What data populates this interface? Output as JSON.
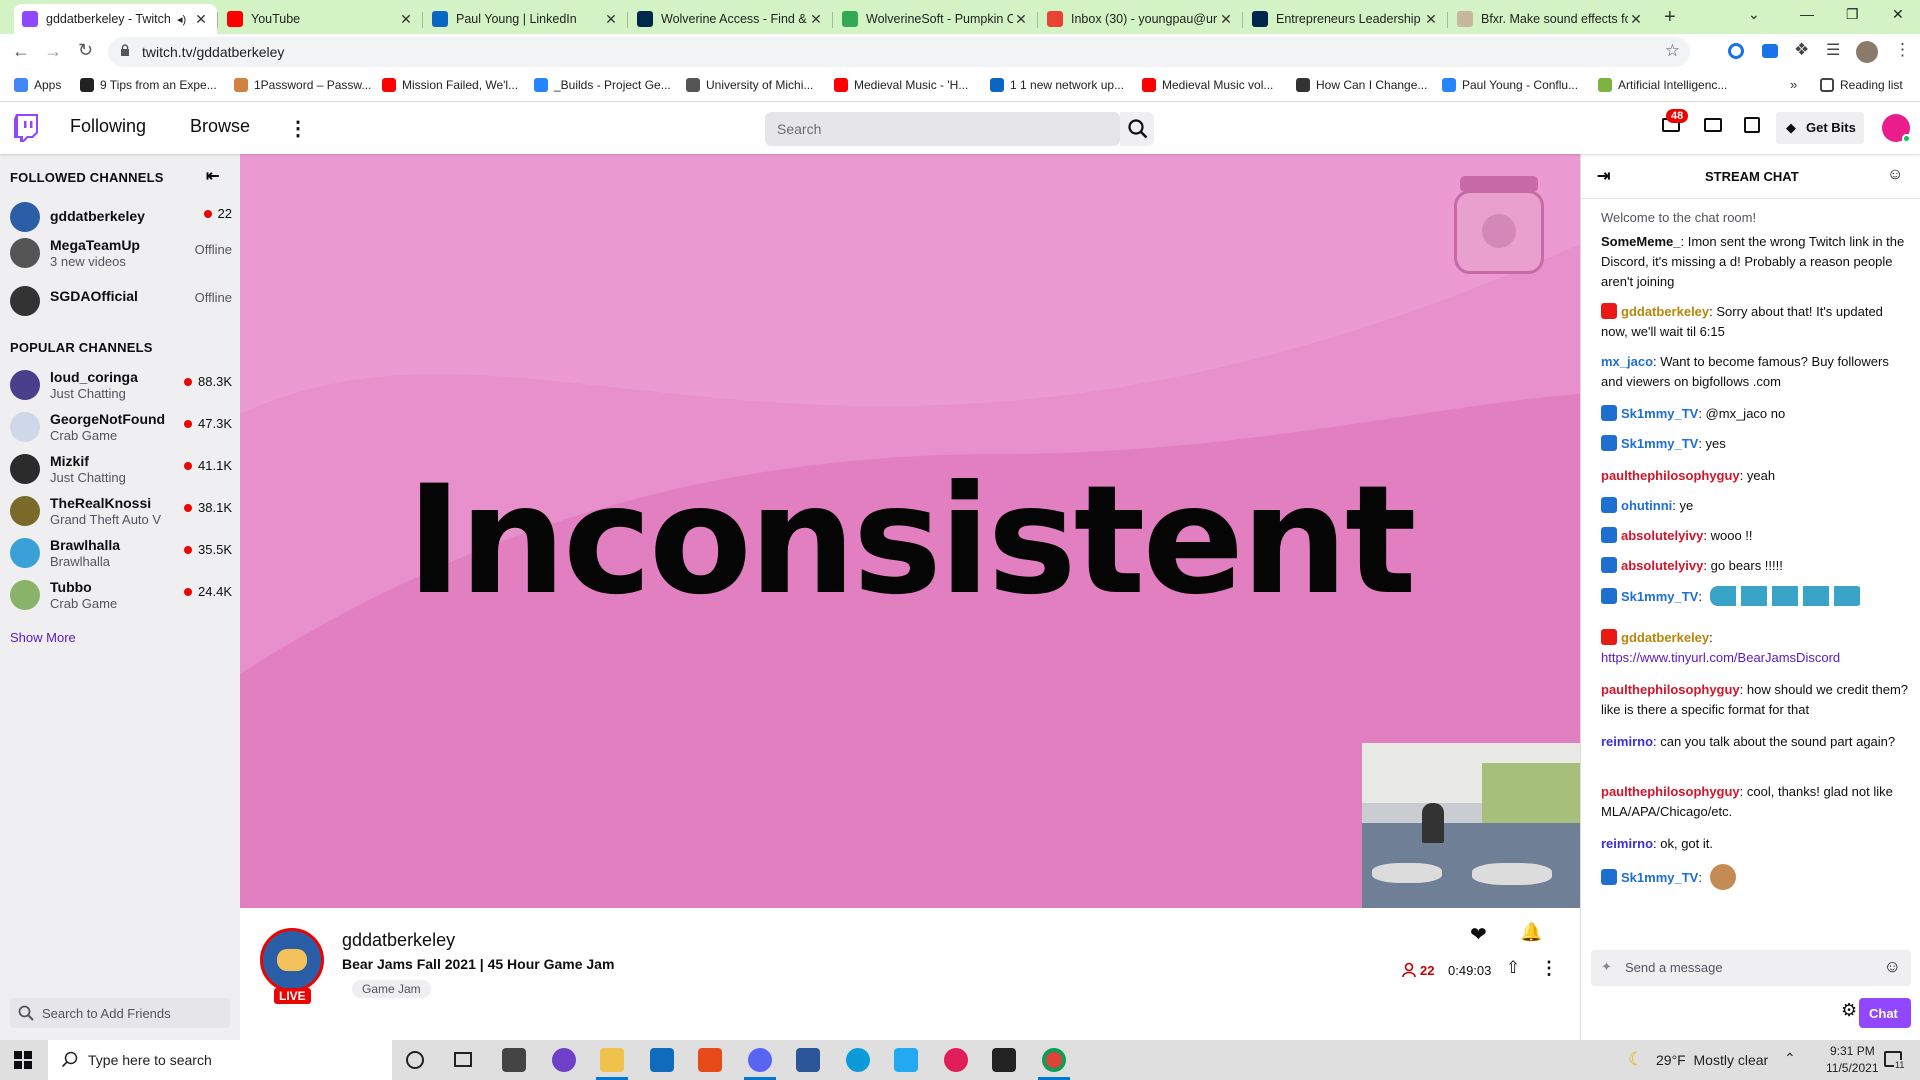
{
  "browser": {
    "tabs": [
      {
        "title": "gddatberkeley - Twitch",
        "favicon_color": "#9146ff",
        "active": true
      },
      {
        "title": "YouTube",
        "favicon_color": "#ff0000"
      },
      {
        "title": "Paul Young | LinkedIn",
        "favicon_color": "#0a66c2"
      },
      {
        "title": "Wolverine Access - Find &",
        "favicon_color": "#00274c"
      },
      {
        "title": "WolverineSoft - Pumpkin C",
        "favicon_color": "#34a853"
      },
      {
        "title": "Inbox (30) - youngpau@ur",
        "favicon_color": "#ea4335"
      },
      {
        "title": "Entrepreneurs Leadership",
        "favicon_color": "#00274c"
      },
      {
        "title": "Bfxr. Make sound effects fo",
        "favicon_color": "#c9b79c"
      }
    ],
    "new_tab": "+",
    "url": "twitch.tv/gddatberkeley",
    "bookmarks": [
      {
        "label": "Apps",
        "color": "#4285f4"
      },
      {
        "label": "9 Tips from an Expe...",
        "color": "#222222"
      },
      {
        "label": "1Password – Passw...",
        "color": "#d08040"
      },
      {
        "label": "Mission Failed, We'l...",
        "color": "#ff0000"
      },
      {
        "label": "_Builds - Project Ge...",
        "color": "#2684ff"
      },
      {
        "label": "University of Michi...",
        "color": "#555555"
      },
      {
        "label": "Medieval Music - 'H...",
        "color": "#ff0000"
      },
      {
        "label": "1 1 new network up...",
        "color": "#0a66c2"
      },
      {
        "label": "Medieval Music vol...",
        "color": "#ff0000"
      },
      {
        "label": "How Can I Change...",
        "color": "#333333"
      },
      {
        "label": "Paul Young - Conflu...",
        "color": "#2684ff"
      },
      {
        "label": "Artificial Intelligenc...",
        "color": "#7cb342"
      }
    ],
    "reading_list": "Reading list"
  },
  "twitch": {
    "nav": {
      "following": "Following",
      "browse": "Browse",
      "search_placeholder": "Search",
      "notif_count": "48",
      "get_bits": "Get Bits"
    },
    "sidebar": {
      "followed_header": "FOLLOWED CHANNELS",
      "followed": [
        {
          "name": "gddatberkeley",
          "viewers": "22",
          "live": true
        },
        {
          "name": "MegaTeamUp",
          "sub": "3 new videos",
          "status": "Offline"
        },
        {
          "name": "SGDAOfficial",
          "status": "Offline"
        }
      ],
      "popular_header": "POPULAR CHANNELS",
      "popular": [
        {
          "name": "loud_coringa",
          "sub": "Just Chatting",
          "viewers": "88.3K"
        },
        {
          "name": "GeorgeNotFound",
          "sub": "Crab Game",
          "viewers": "47.3K"
        },
        {
          "name": "Mizkif",
          "sub": "Just Chatting",
          "viewers": "41.1K"
        },
        {
          "name": "TheRealKnossi",
          "sub": "Grand Theft Auto V",
          "viewers": "38.1K"
        },
        {
          "name": "Brawlhalla",
          "sub": "Brawlhalla",
          "viewers": "35.5K"
        },
        {
          "name": "Tubbo",
          "sub": "Crab Game",
          "viewers": "24.4K"
        }
      ],
      "show_more": "Show More",
      "friends_placeholder": "Search to Add Friends"
    },
    "video": {
      "slide_text": "Inconsistent"
    },
    "channel": {
      "name": "gddatberkeley",
      "title": "Bear Jams Fall 2021 | 45 Hour Game Jam",
      "tag": "Game Jam",
      "live_badge": "LIVE",
      "viewers": "22",
      "uptime": "0:49:03"
    },
    "chat": {
      "header": "STREAM CHAT",
      "welcome": "Welcome to the chat room!",
      "messages": [
        {
          "user": "SomeMeme_",
          "color": "#0e0e10",
          "badge": "",
          "text": ": Imon sent the wrong Twitch link in the Discord, it's missing a d! Probably a reason people aren't joining"
        },
        {
          "user": "gddatberkeley",
          "color": "#b8860b",
          "badge": "broadcaster",
          "text": ": Sorry about that! It's updated now, we'll wait til 6:15"
        },
        {
          "user": "mx_jaco",
          "color": "#1e6fd0",
          "badge": "",
          "text": ": Want to become famous? Buy followers and viewers on bigfollows .com"
        },
        {
          "user": "Sk1mmy_TV",
          "color": "#1e6fd0",
          "badge": "prime",
          "text": ": @mx_jaco no"
        },
        {
          "user": "Sk1mmy_TV",
          "color": "#1e6fd0",
          "badge": "prime",
          "text": ": yes"
        },
        {
          "user": "paulthephilosophyguy",
          "color": "#d1162b",
          "badge": "",
          "text": ": yeah"
        },
        {
          "user": "ohutinni",
          "color": "#1e6fd0",
          "badge": "prime",
          "text": ": ye"
        },
        {
          "user": "absolutelyivy",
          "color": "#d1162b",
          "badge": "prime",
          "text": ": wooo !!"
        },
        {
          "user": "absolutelyivy",
          "color": "#d1162b",
          "badge": "prime",
          "text": ": go bears !!!!!"
        },
        {
          "user": "Sk1mmy_TV",
          "color": "#1e6fd0",
          "badge": "prime",
          "text": ": "
        },
        {
          "user": "gddatberkeley",
          "color": "#b8860b",
          "badge": "broadcaster",
          "text": ":",
          "link": "https://www.tinyurl.com/BearJamsDiscord"
        },
        {
          "user": "paulthephilosophyguy",
          "color": "#d1162b",
          "badge": "",
          "text": ": how should we credit them? like is there a specific format for that"
        },
        {
          "user": "reimirno",
          "color": "#3b2fd6",
          "badge": "",
          "text": ": can you talk about the sound part again?"
        },
        {
          "user": "paulthephilosophyguy",
          "color": "#d1162b",
          "badge": "",
          "text": ": cool, thanks! glad not like MLA/APA/Chicago/etc."
        },
        {
          "user": "reimirno",
          "color": "#3b2fd6",
          "badge": "",
          "text": ": ok, got it."
        },
        {
          "user": "Sk1mmy_TV",
          "color": "#1e6fd0",
          "badge": "prime",
          "text": ": "
        }
      ],
      "input_placeholder": "Send a message",
      "send": "Chat"
    }
  },
  "taskbar": {
    "search_placeholder": "Type here to search",
    "weather": "29°F  Mostly clear",
    "time": "9:31 PM",
    "date": "11/5/2021",
    "notif": "11"
  },
  "colors": {
    "twitch_purple": "#9146ff",
    "live_red": "#eb0400",
    "video_pink": "#e890cc"
  }
}
